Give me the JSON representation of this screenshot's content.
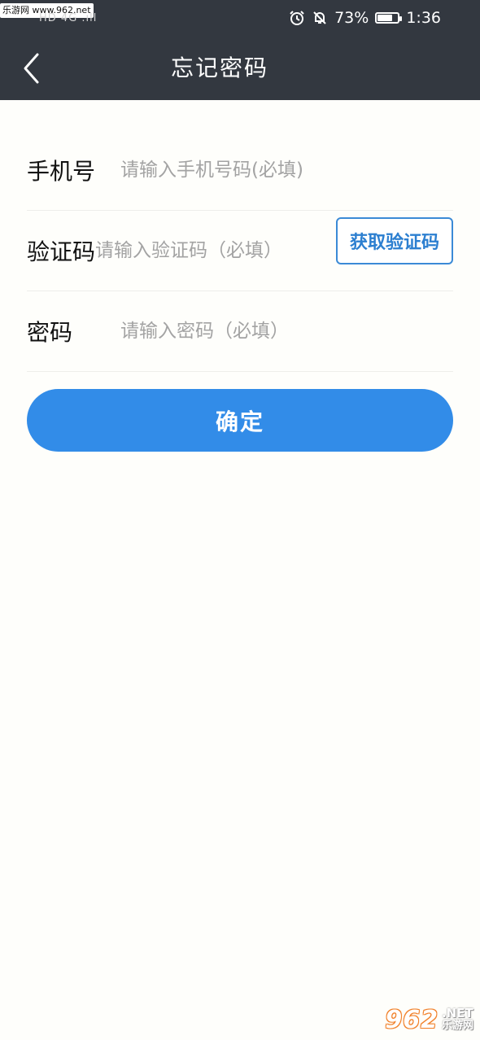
{
  "status_bar": {
    "watermark": "乐游网 www.962.net",
    "signal_text": "HD 4G .ıll",
    "battery_percent": "73%",
    "battery_level": 0.73,
    "time": "1:36"
  },
  "navbar": {
    "title": "忘记密码"
  },
  "form": {
    "phone": {
      "label": "手机号",
      "placeholder": "请输入手机号码(必填)"
    },
    "code": {
      "label": "验证码",
      "placeholder": "请输入验证码（必填）",
      "button": "获取验证码"
    },
    "password": {
      "label": "密码",
      "placeholder": "请输入密码（必填）"
    }
  },
  "submit_label": "确定",
  "watermark_br": {
    "number": "962",
    "net": ".NET",
    "cn": "乐游网"
  },
  "colors": {
    "header_bg": "#333840",
    "primary": "#328ce8",
    "code_border": "#3b8ad6",
    "background": "#fefefb"
  }
}
